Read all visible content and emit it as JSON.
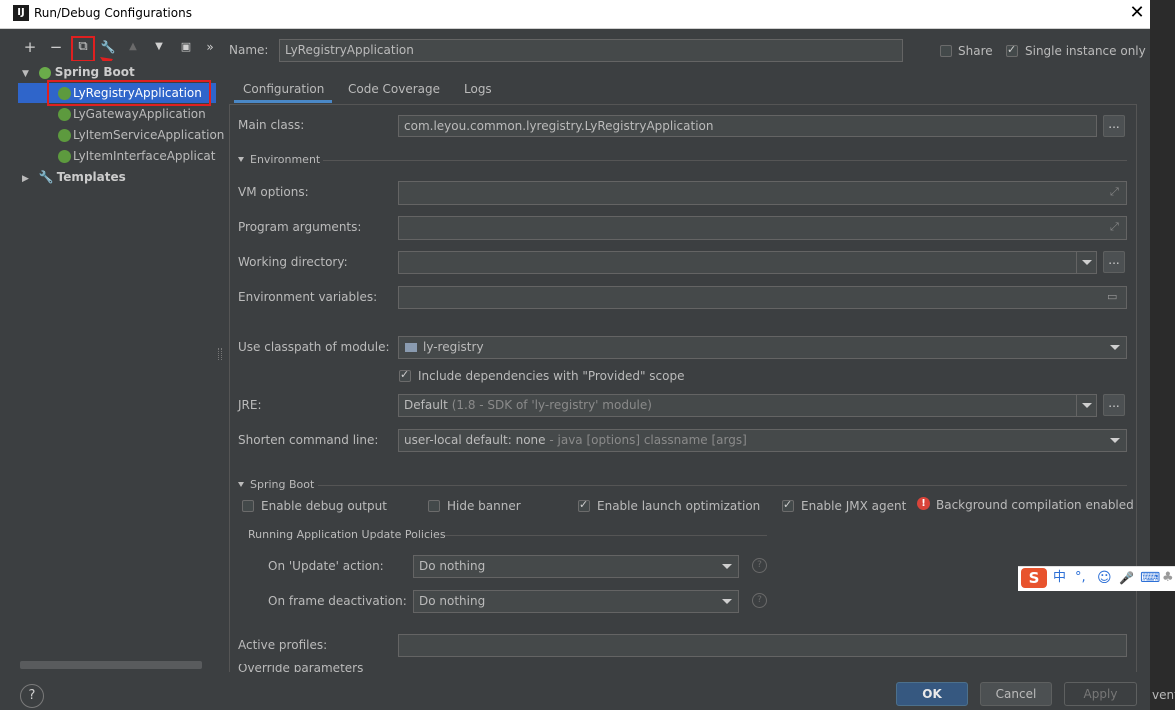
{
  "window": {
    "title": "Run/Debug Configurations",
    "close_glyph": "✕",
    "app_icon_letter": "IJ"
  },
  "toolbar": {
    "add": "+",
    "remove": "−",
    "copy": "⧉",
    "edit_defaults": "🔧",
    "move_up": "▲",
    "move_down": "▼",
    "folder": "▣",
    "more": "»"
  },
  "tree": {
    "group_spring": "Spring Boot",
    "items": [
      {
        "label": "LyRegistryApplication",
        "selected": true
      },
      {
        "label": "LyGatewayApplication"
      },
      {
        "label": "LyItemServiceApplication"
      },
      {
        "label": "LyItemInterfaceApplicatio"
      }
    ],
    "templates": "Templates"
  },
  "name_row": {
    "label": "Name:",
    "value": "LyRegistryApplication",
    "share": "Share",
    "single_instance": "Single instance only"
  },
  "tabs": [
    "Configuration",
    "Code Coverage",
    "Logs"
  ],
  "config": {
    "main_class_label": "Main class:",
    "main_class_value": "com.leyou.common.lyregistry.LyRegistryApplication",
    "environment_section": "Environment",
    "vm_options_label": "VM options:",
    "program_args_label": "Program arguments:",
    "working_dir_label": "Working directory:",
    "env_vars_label": "Environment variables:",
    "classpath_label": "Use classpath of module:",
    "classpath_value": "ly-registry",
    "include_provided": "Include dependencies with \"Provided\" scope",
    "jre_label": "JRE:",
    "jre_value": "Default",
    "jre_hint": "(1.8 - SDK of 'ly-registry' module)",
    "shorten_label": "Shorten command line:",
    "shorten_value": "user-local default: none",
    "shorten_hint": "- java [options] classname [args]",
    "spring_boot_section": "Spring Boot",
    "enable_debug": "Enable debug output",
    "hide_banner": "Hide banner",
    "enable_launch_opt": "Enable launch optimization",
    "enable_jmx": "Enable JMX agent",
    "bg_compilation": "Background compilation enabled",
    "running_policies": "Running Application Update Policies",
    "on_update_label": "On 'Update' action:",
    "on_update_value": "Do nothing",
    "on_frame_label": "On frame deactivation:",
    "on_frame_value": "Do nothing",
    "active_profiles_label": "Active profiles:",
    "override_partial": "Override parameters"
  },
  "buttons": {
    "ok": "OK",
    "cancel": "Cancel",
    "apply": "Apply",
    "help": "?",
    "dots": "..."
  },
  "ime": {
    "logo": "S",
    "chinese": "中",
    "punct": "°,",
    "smile": "☺",
    "mic": "🎤",
    "keyboard": "⌨",
    "more": "♣"
  },
  "background_text": {
    "right_edge": "vent"
  },
  "colors": {
    "accent": "#4a88c7",
    "selection": "#2f65ca",
    "annotation": "#e02020",
    "ok_button": "#365880"
  }
}
